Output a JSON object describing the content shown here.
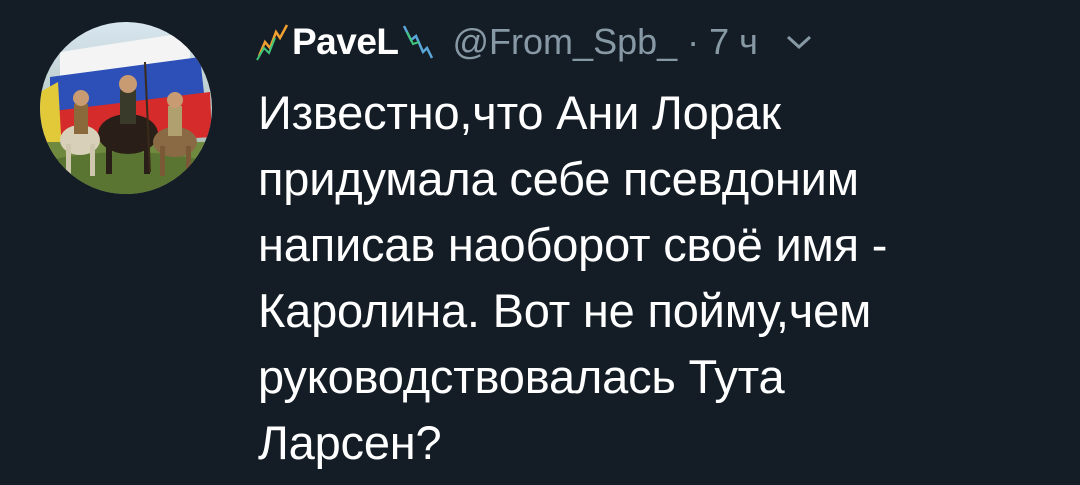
{
  "tweet": {
    "author": {
      "display_name": "PaveL",
      "handle": "@From_Spb_",
      "avatar_icon": "avatar-image"
    },
    "separator": "·",
    "timestamp": "7 ч",
    "menu_icon": "chevron-down-icon",
    "text_lines": [
      "Известно,что Ани Лорак",
      "придумала себе псевдоним",
      "написав наоборот своё имя -",
      "Каролина. Вот не пойму,чем",
      "руководствовалась Тута",
      "Ларсен?"
    ]
  },
  "colors": {
    "background": "#141d26",
    "text_primary": "#ffffff",
    "text_secondary": "#8899a6",
    "deco_green": "#3fc47a",
    "deco_orange": "#f0a030",
    "deco_blue": "#5aa6d8"
  }
}
